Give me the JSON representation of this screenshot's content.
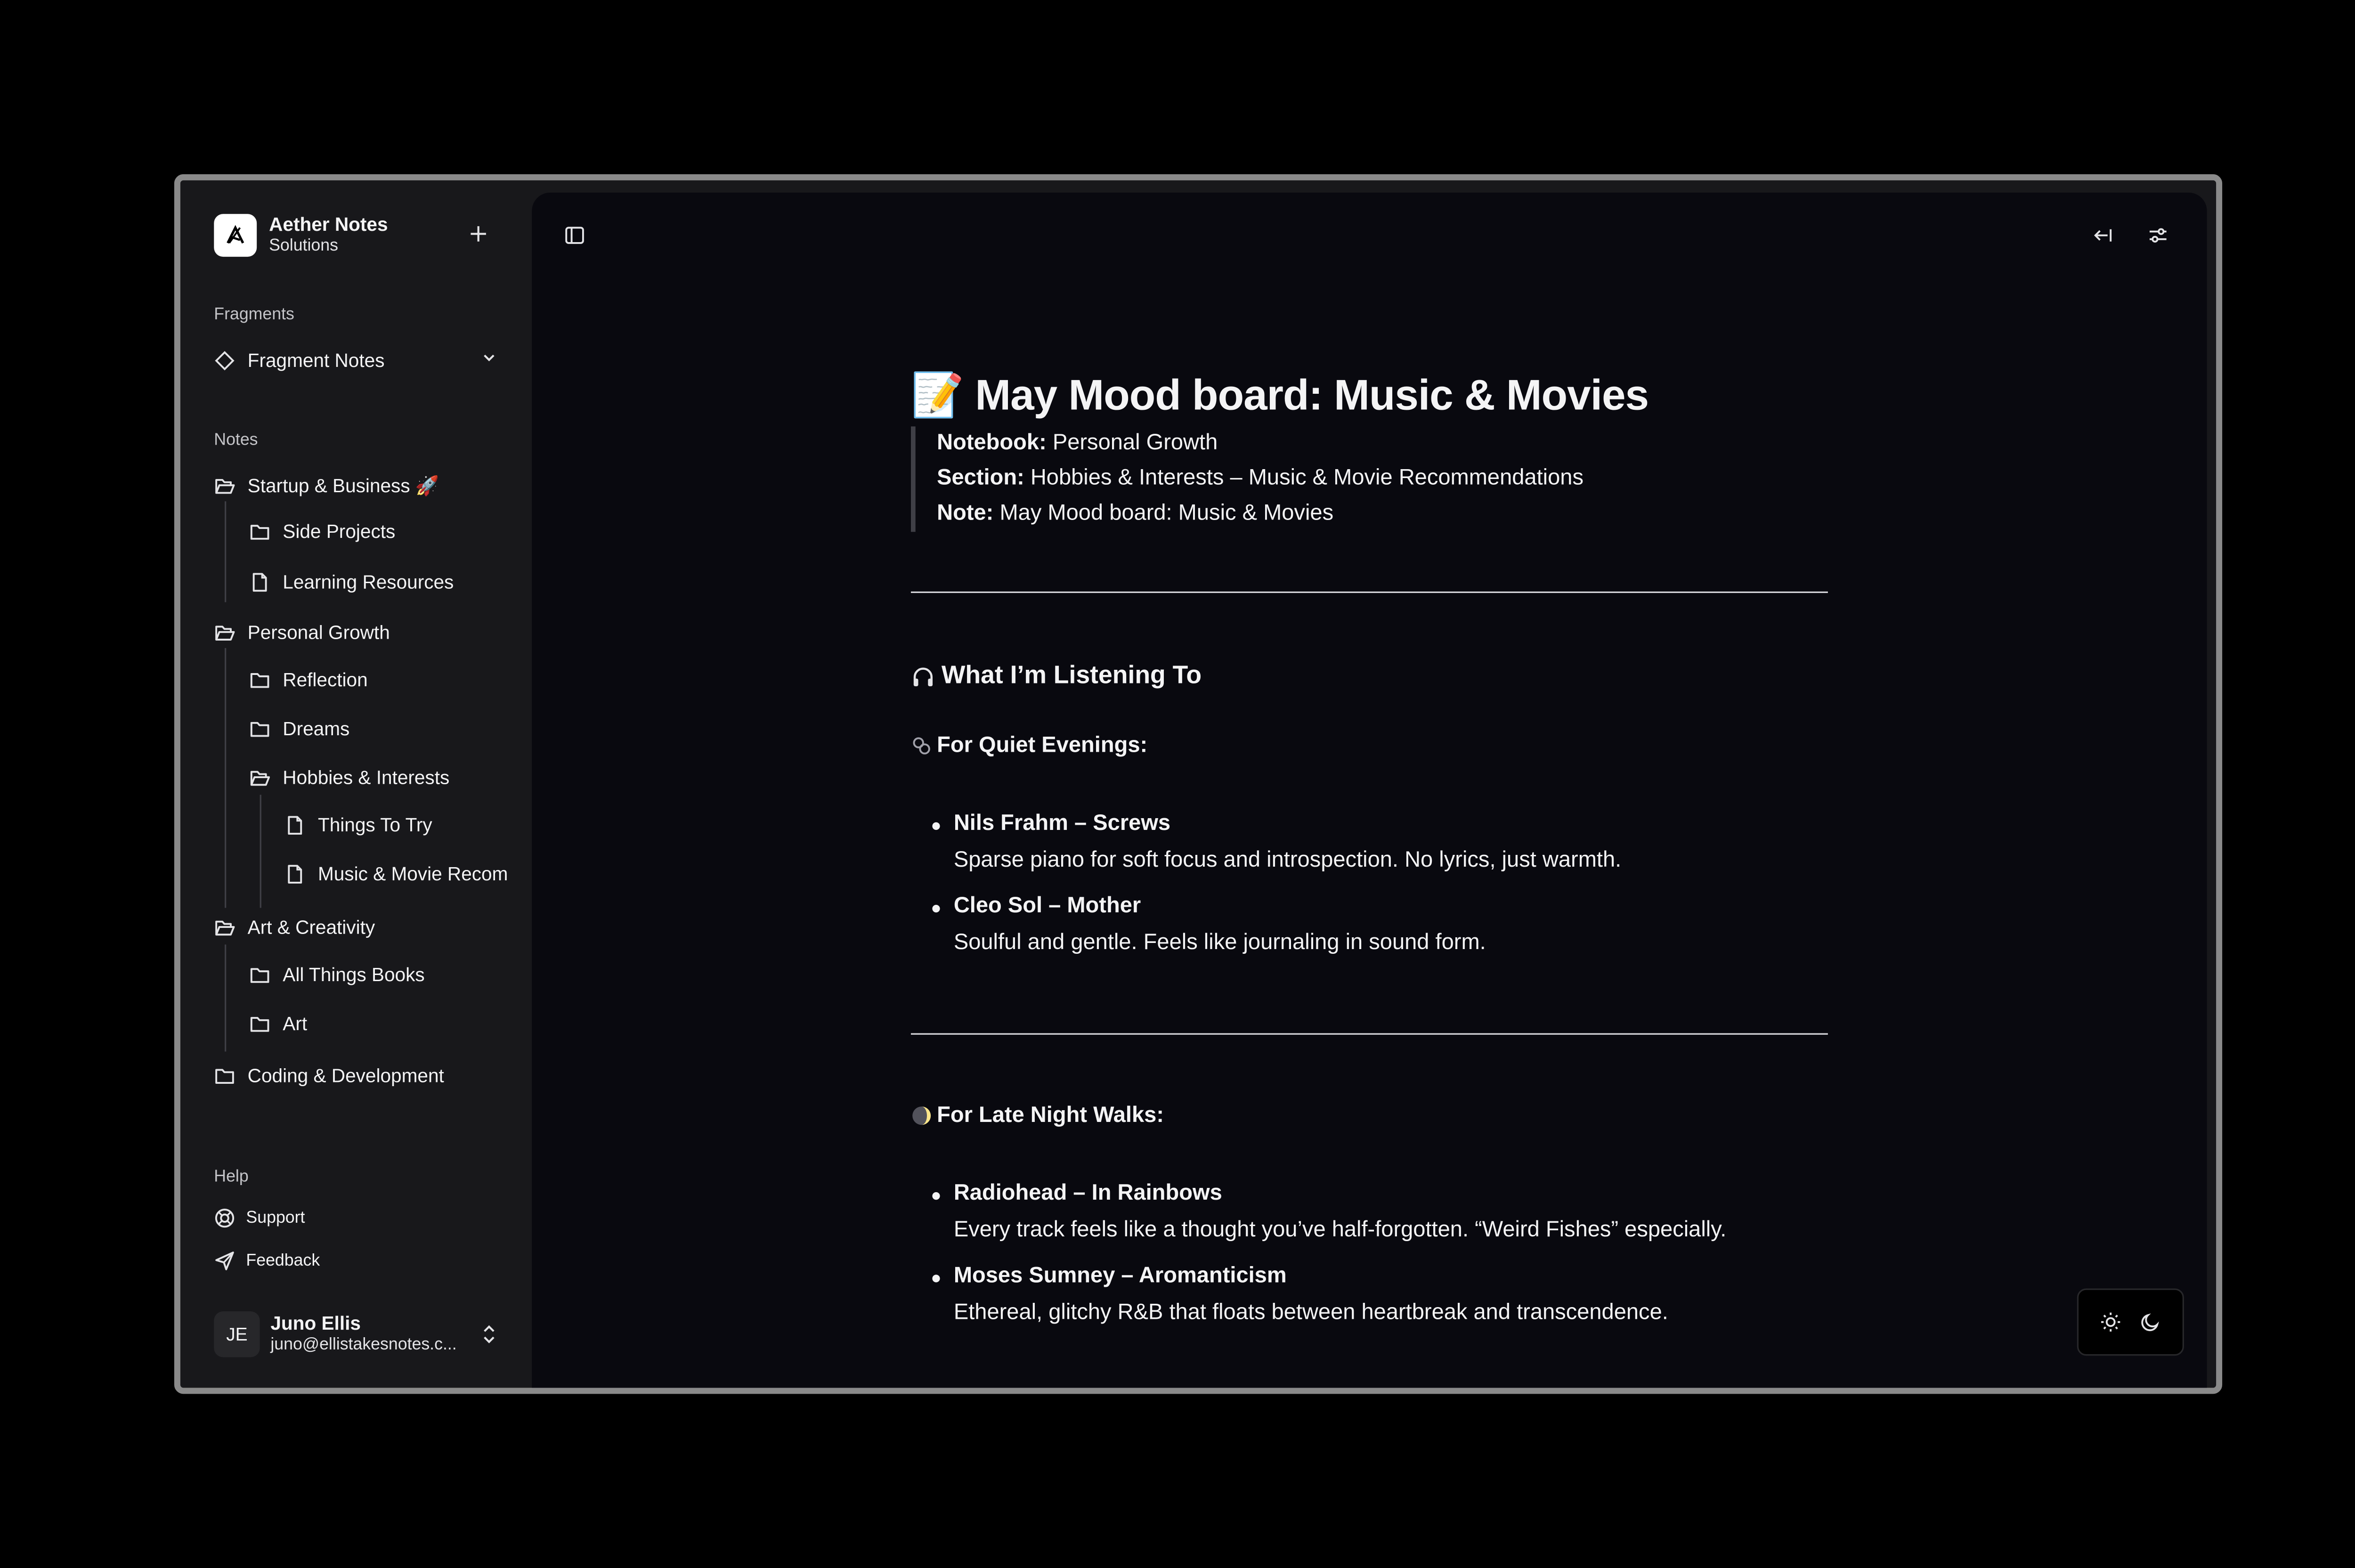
{
  "app": {
    "name": "Aether Notes",
    "subtitle": "Solutions"
  },
  "sidebar": {
    "fragments_label": "Fragments",
    "fragment_notes": "Fragment Notes",
    "notes_label": "Notes",
    "tree": [
      {
        "label": "Startup & Business 🚀",
        "type": "folder-open",
        "level": 0
      },
      {
        "label": "Side Projects",
        "type": "folder",
        "level": 1
      },
      {
        "label": "Learning Resources",
        "type": "file",
        "level": 1
      },
      {
        "label": "Personal Growth",
        "type": "folder-open",
        "level": 0
      },
      {
        "label": "Reflection",
        "type": "folder",
        "level": 1
      },
      {
        "label": "Dreams",
        "type": "folder",
        "level": 1
      },
      {
        "label": "Hobbies & Interests",
        "type": "folder-open",
        "level": 1
      },
      {
        "label": "Things To Try",
        "type": "file",
        "level": 2
      },
      {
        "label": "Music & Movie Recommendations",
        "type": "file",
        "level": 2
      },
      {
        "label": "Art & Creativity",
        "type": "folder-open",
        "level": 0
      },
      {
        "label": "All Things Books",
        "type": "folder",
        "level": 1
      },
      {
        "label": "Art",
        "type": "folder",
        "level": 1
      },
      {
        "label": "Coding & Development",
        "type": "folder",
        "level": 0
      }
    ],
    "help_label": "Help",
    "support": "Support",
    "feedback": "Feedback"
  },
  "user": {
    "initials": "JE",
    "name": "Juno Ellis",
    "email": "juno@ellistakesnotes.c..."
  },
  "note": {
    "title": "📝 May Mood board: Music & Movies",
    "notebook_label": "Notebook:",
    "notebook_value": "Personal Growth",
    "section_label": "Section:",
    "section_value": "Hobbies & Interests – Music & Movie Recommendations",
    "note_label": "Note:",
    "note_value": "May Mood board: Music & Movies",
    "listening_heading": "What I’m Listening To",
    "quiet_heading": "For Quiet Evenings:",
    "quiet_items": [
      {
        "title": "Nils Frahm – Screws",
        "desc": "Sparse piano for soft focus and introspection. No lyrics, just warmth."
      },
      {
        "title": "Cleo Sol – Mother",
        "desc": "Soulful and gentle. Feels like journaling in sound form."
      }
    ],
    "night_heading": "For Late Night Walks:",
    "night_items": [
      {
        "title": "Radiohead – In Rainbows",
        "desc": "Every track feels like a thought you’ve half-forgotten. “Weird Fishes” especially."
      },
      {
        "title": "Moses Sumney – Aromanticism",
        "desc": "Ethereal, glitchy R&B that floats between heartbreak and transcendence."
      }
    ]
  }
}
